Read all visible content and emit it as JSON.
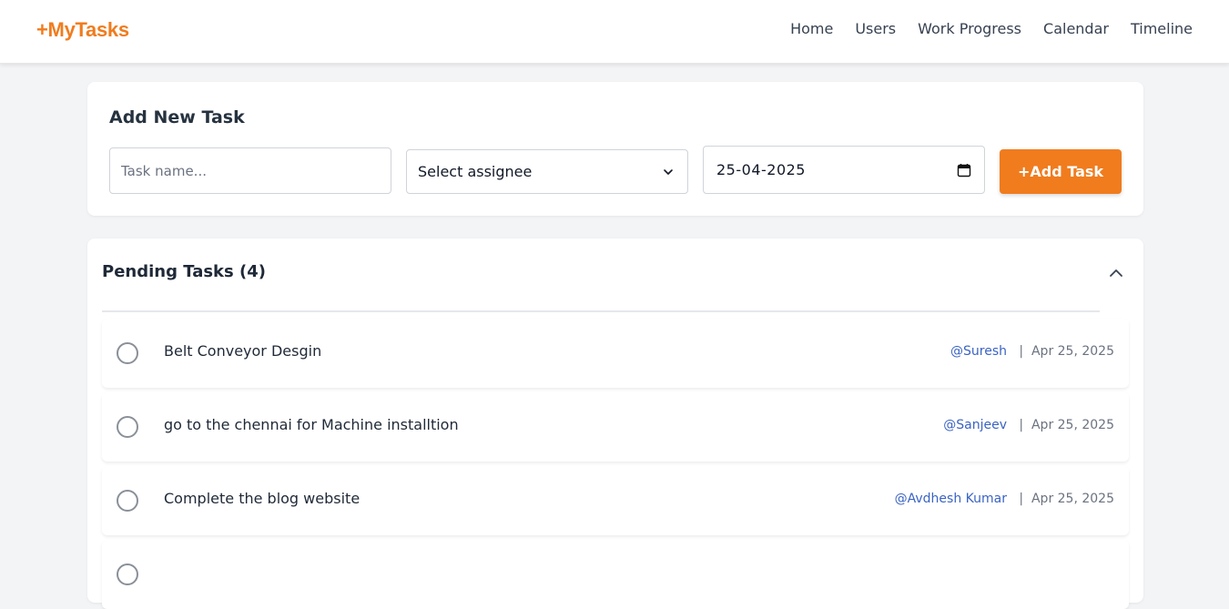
{
  "header": {
    "brand": "+MyTasks",
    "nav": [
      "Home",
      "Users",
      "Work Progress",
      "Calendar",
      "Timeline"
    ]
  },
  "add_task": {
    "title": "Add New Task",
    "task_placeholder": "Task name...",
    "assignee_value": "Select assignee",
    "date_value": "25-04-2025",
    "button_label": "+Add Task"
  },
  "pending": {
    "title": "Pending Tasks (4)",
    "tasks": [
      {
        "name": "Belt Conveyor Desgin",
        "user": "@Suresh",
        "date": "Apr 25, 2025"
      },
      {
        "name": "go to the chennai for Machine installtion",
        "user": "@Sanjeev",
        "date": "Apr 25, 2025"
      },
      {
        "name": "Complete the blog website",
        "user": "@Avdhesh Kumar",
        "date": "Apr 25, 2025"
      }
    ],
    "separator": "|"
  },
  "colors": {
    "accent": "#f07c1e",
    "user_link": "#3b63c4",
    "background": "#f3f4f6"
  }
}
